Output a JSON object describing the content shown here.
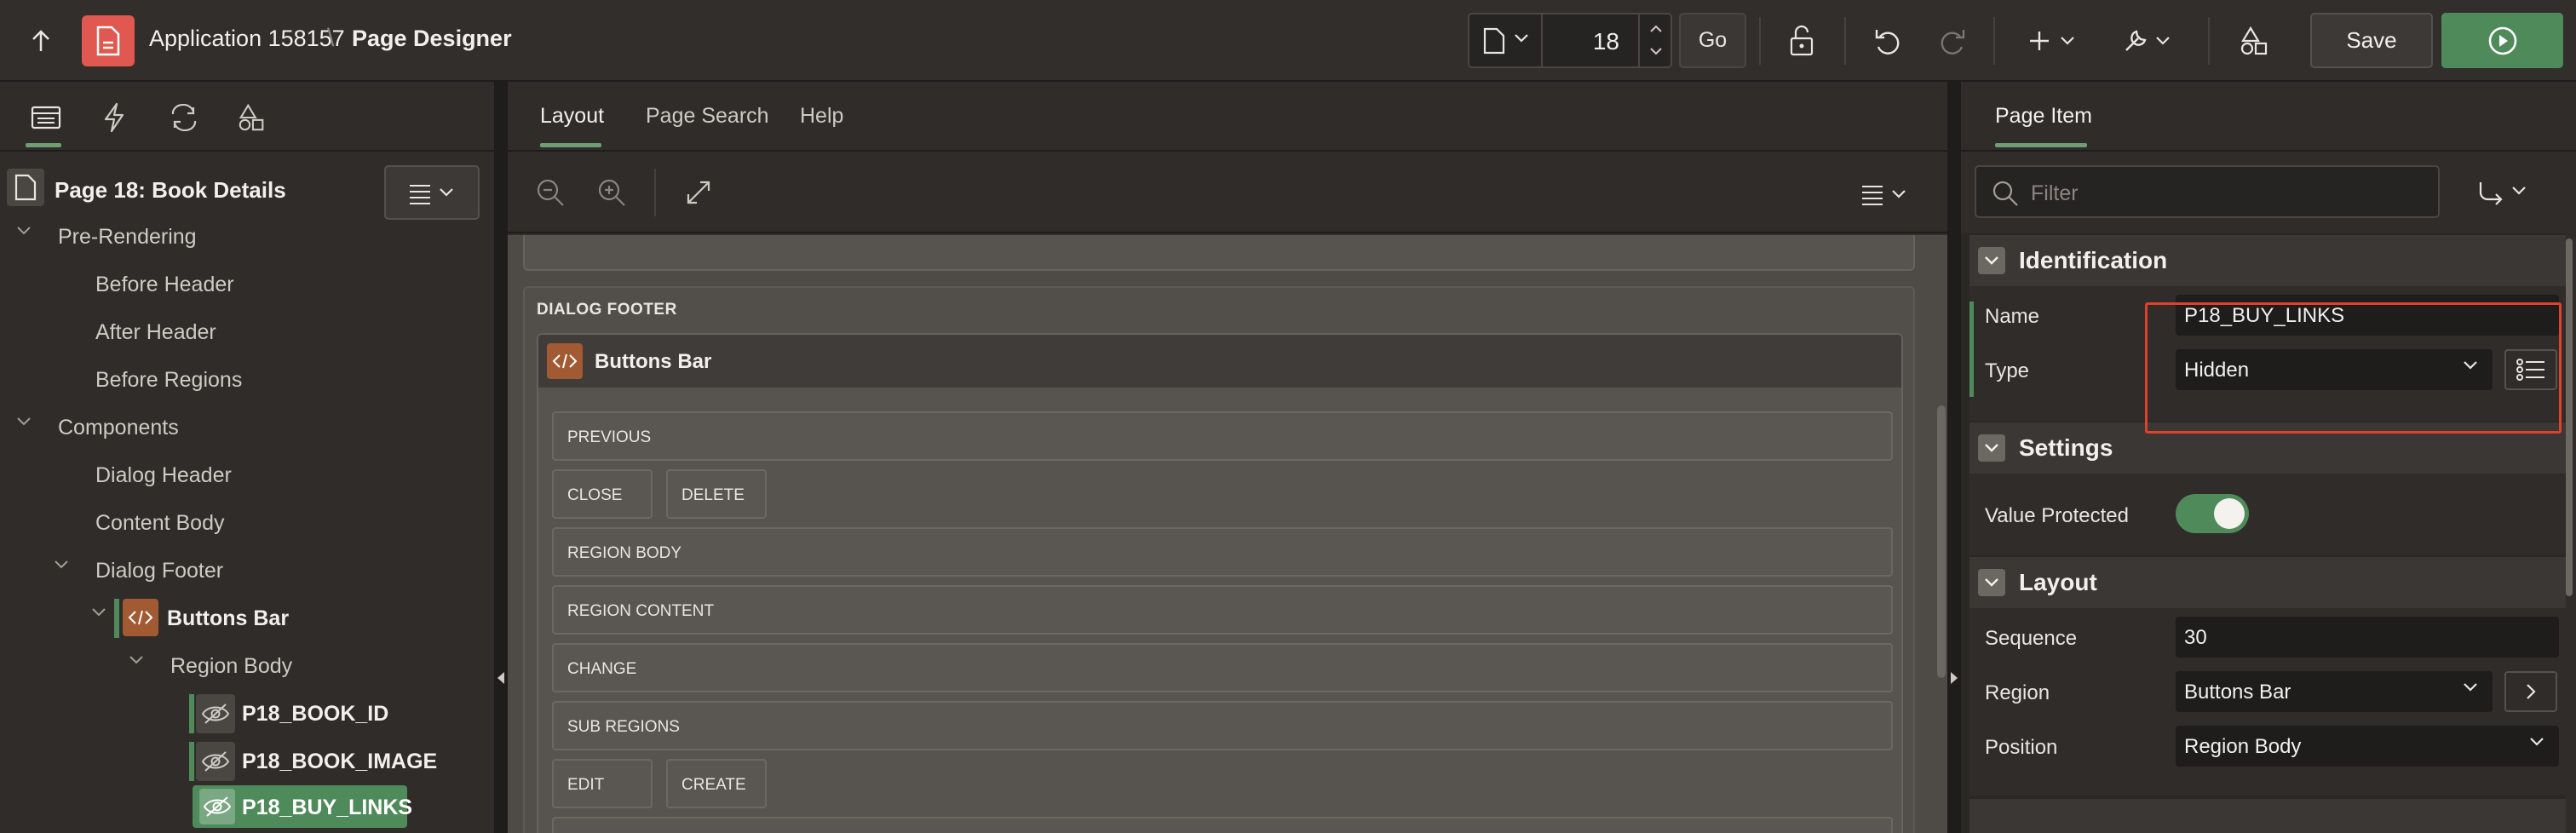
{
  "header": {
    "app_name": "Application 158157",
    "separator": "\\",
    "page_designer": "Page Designer",
    "page_number": "18",
    "go_label": "Go",
    "save_label": "Save"
  },
  "left_panel": {
    "tree": {
      "page_title": "Page 18: Book Details",
      "pre_rendering": "Pre-Rendering",
      "before_header": "Before Header",
      "after_header": "After Header",
      "before_regions": "Before Regions",
      "components": "Components",
      "dialog_header": "Dialog Header",
      "content_body": "Content Body",
      "dialog_footer": "Dialog Footer",
      "buttons_bar": "Buttons Bar",
      "region_body": "Region Body",
      "item_book_id": "P18_BOOK_ID",
      "item_book_image": "P18_BOOK_IMAGE",
      "item_buy_links": "P18_BUY_LINKS"
    }
  },
  "center": {
    "tabs": [
      "Layout",
      "Page Search",
      "Help"
    ],
    "dialog_footer_label": "DIALOG FOOTER",
    "buttons_bar_title": "Buttons Bar",
    "slots": {
      "previous": "PREVIOUS",
      "close": "CLOSE",
      "delete": "DELETE",
      "region_body": "REGION BODY",
      "region_content": "REGION CONTENT",
      "change": "CHANGE",
      "sub_regions": "SUB REGIONS",
      "edit": "EDIT",
      "create": "CREATE"
    }
  },
  "right_panel": {
    "tab": "Page Item",
    "filter_placeholder": "Filter",
    "identification": {
      "title": "Identification",
      "name_label": "Name",
      "name_value": "P18_BUY_LINKS",
      "type_label": "Type",
      "type_value": "Hidden"
    },
    "settings": {
      "title": "Settings",
      "value_protected_label": "Value Protected",
      "value_protected": true
    },
    "layout": {
      "title": "Layout",
      "sequence_label": "Sequence",
      "sequence_value": "30",
      "region_label": "Region",
      "region_value": "Buttons Bar",
      "position_label": "Position",
      "position_value": "Region Body"
    }
  },
  "colors": {
    "accent_green": "#4f8a5b",
    "app_icon": "#e0584f",
    "highlight_red": "#e0412d",
    "region_icon": "#a25a33"
  }
}
